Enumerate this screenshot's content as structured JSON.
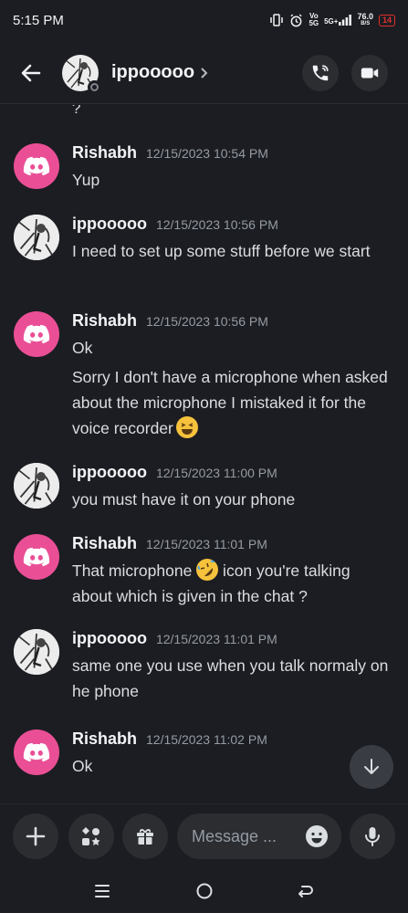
{
  "status_bar": {
    "time": "5:15 PM",
    "volte": "Vo",
    "net_5g": "5G",
    "signal_label": "5G+",
    "speed_value": "76.0",
    "speed_unit": "B/S",
    "battery": "14"
  },
  "header": {
    "contact_name": "ippooooo",
    "status": "offline"
  },
  "messages": {
    "previous_text": "?",
    "items": [
      {
        "author": "Rishabh",
        "timestamp": "12/15/2023 10:54 PM",
        "lines": [
          "Yup"
        ]
      },
      {
        "author": "ippooooo",
        "timestamp": "12/15/2023 10:56 PM",
        "lines": [
          "I need to set up some stuff before we start"
        ]
      },
      {
        "author": "Rishabh",
        "timestamp": "12/15/2023 10:56 PM",
        "lines": [
          "Ok",
          "Sorry I don't have a microphone when asked about the microphone I mistaked it for the voice recorder"
        ],
        "emoji": "grinning-squinting-face"
      },
      {
        "author": "ippooooo",
        "timestamp": "12/15/2023 11:00 PM",
        "lines": [
          "you must have it on your phone"
        ]
      },
      {
        "author": "Rishabh",
        "timestamp": "12/15/2023 11:01 PM",
        "lines_parts": [
          "That microphone ",
          " icon you're talking about which is given in the chat ?"
        ],
        "emoji": "rolling-on-floor-laughing"
      },
      {
        "author": "ippooooo",
        "timestamp": "12/15/2023 11:01 PM",
        "lines": [
          "same one you use when you talk normaly on he phone"
        ]
      },
      {
        "author": "Rishabh",
        "timestamp": "12/15/2023 11:02 PM",
        "lines": [
          "Ok"
        ]
      }
    ]
  },
  "composer": {
    "placeholder": "Message ..."
  },
  "icons": {
    "back": "arrow-left-icon",
    "call": "phone-icon",
    "video": "video-camera-icon",
    "plus": "plus-icon",
    "apps": "apps-icon",
    "gift": "gift-icon",
    "emoji": "emoji-icon",
    "mic": "microphone-icon",
    "scroll": "arrow-down-icon"
  },
  "colors": {
    "background": "#1c1d22",
    "discord_avatar": "#ea4f96",
    "timestamp": "#949ba4",
    "battery_low": "#e0302d"
  }
}
